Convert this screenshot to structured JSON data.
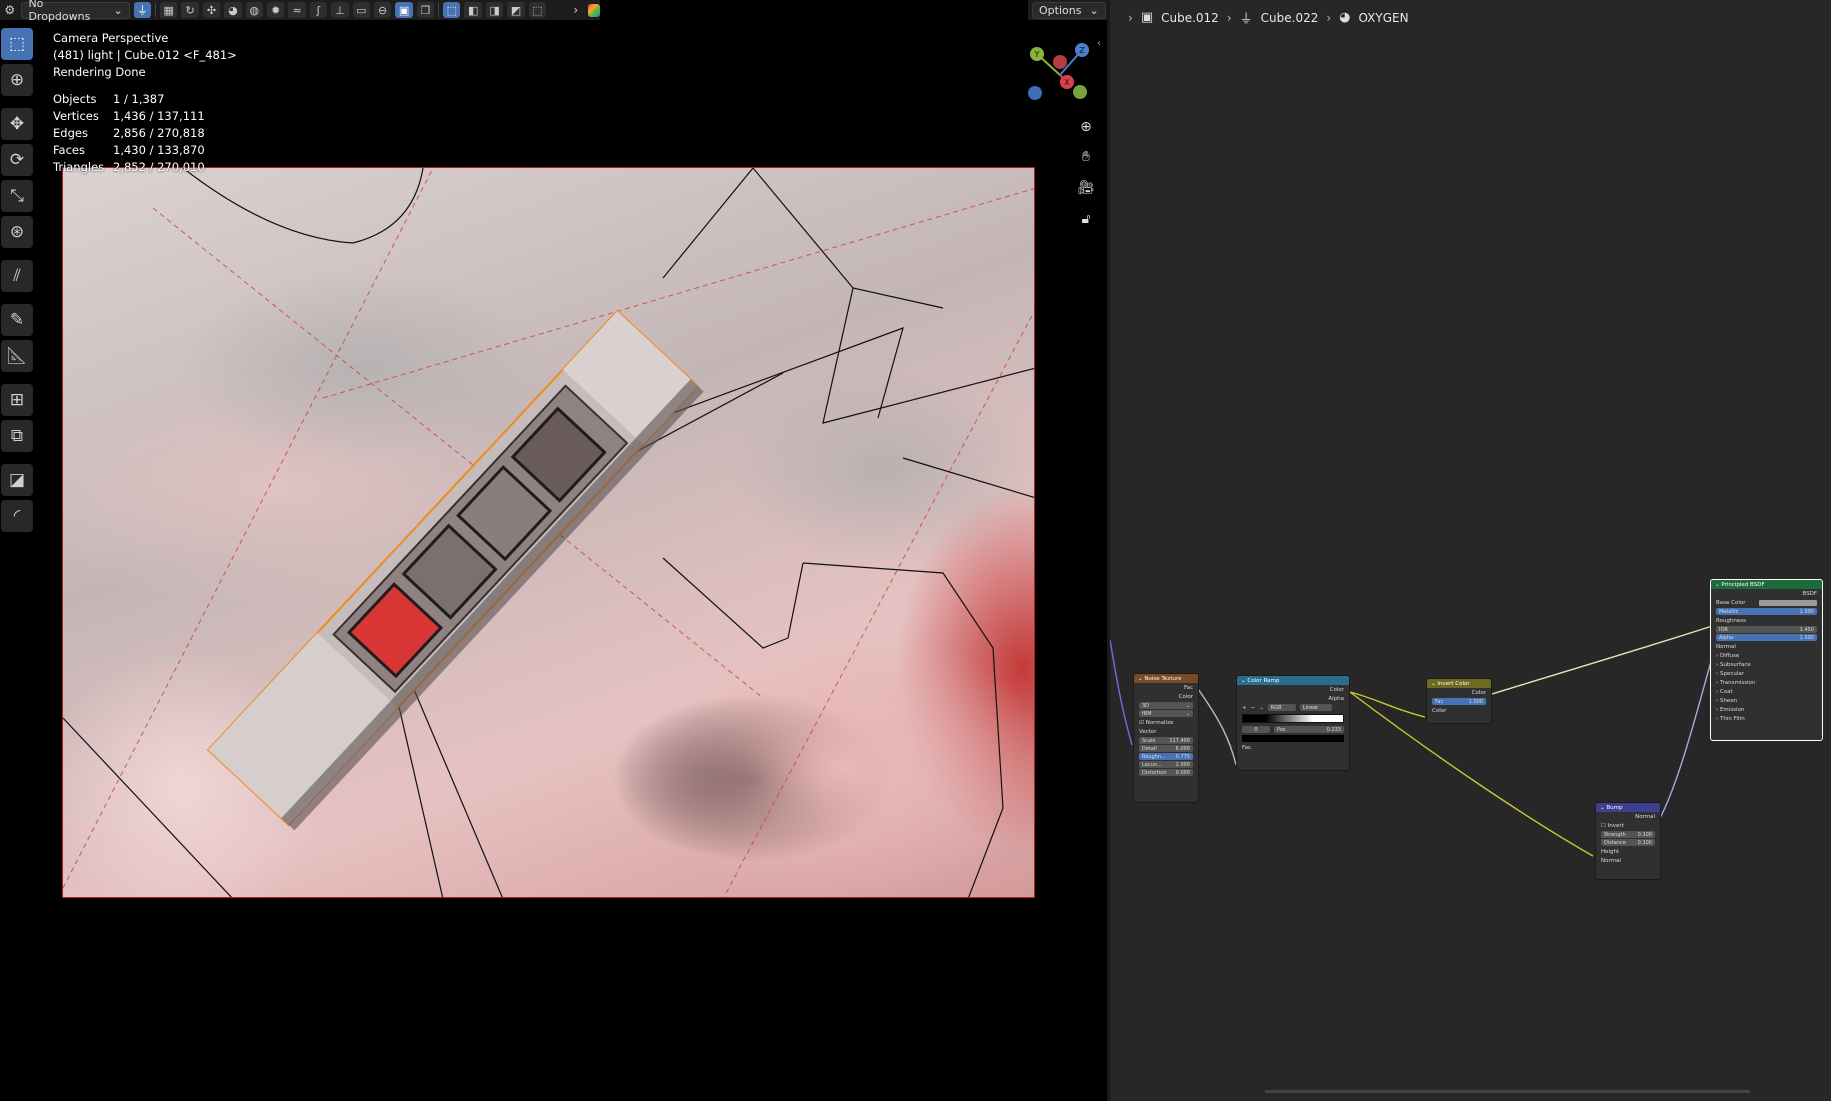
{
  "viewport_header": {
    "dropdown_label": "No Dropdowns",
    "options_label": "Options"
  },
  "stats": {
    "title": "Camera Perspective",
    "subtitle": "(481) light | Cube.012 <F_481>",
    "status": "Rendering Done",
    "rows": [
      {
        "label": "Objects",
        "value": "1 / 1,387"
      },
      {
        "label": "Vertices",
        "value": "1,436 / 137,111"
      },
      {
        "label": "Edges",
        "value": "2,856 / 270,818"
      },
      {
        "label": "Faces",
        "value": "1,430 / 133,870"
      },
      {
        "label": "Triangles",
        "value": "2,852 / 270,010"
      }
    ]
  },
  "gizmo": {
    "y": "Y",
    "z": "Z",
    "x": "X"
  },
  "breadcrumb": {
    "object": "Cube.012",
    "mesh": "Cube.022",
    "material": "OXYGEN"
  },
  "nodes": {
    "noise": {
      "title": "Noise Texture",
      "out_fac": "Fac",
      "out_color": "Color",
      "dim": "3D",
      "type": "fBM",
      "normalize": "Normalize",
      "vector": "Vector",
      "scale_l": "Scale",
      "scale_v": "117.400",
      "detail_l": "Detail",
      "detail_v": "6.000",
      "rough_l": "Roughn...",
      "rough_v": "0.775",
      "lacun_l": "Lacun...",
      "lacun_v": "2.000",
      "dist_l": "Distortion",
      "dist_v": "0.000"
    },
    "ramp": {
      "title": "Color Ramp",
      "out_color": "Color",
      "out_alpha": "Alpha",
      "mode": "RGB",
      "interp": "Linear",
      "idx": "0",
      "pos_l": "Pos",
      "pos_v": "0.233",
      "in_fac": "Fac"
    },
    "invert": {
      "title": "Invert Color",
      "out_color": "Color",
      "fac_l": "Fac",
      "fac_v": "1.000",
      "in_color": "Color"
    },
    "bump": {
      "title": "Bump",
      "out_normal": "Normal",
      "invert": "Invert",
      "strength_l": "Strength",
      "strength_v": "0.100",
      "distance_l": "Distance",
      "distance_v": "0.100",
      "height": "Height",
      "normal": "Normal"
    },
    "bsdf": {
      "title": "Principled BSDF",
      "out": "BSDF",
      "base_color": "Base Color",
      "metallic_l": "Metallic",
      "metallic_v": "1.000",
      "roughness": "Roughness",
      "ior_l": "IOR",
      "ior_v": "1.450",
      "alpha_l": "Alpha",
      "alpha_v": "1.000",
      "normal": "Normal",
      "panels": [
        "Diffuse",
        "Subsurface",
        "Specular",
        "Transmission",
        "Coat",
        "Sheen",
        "Emission",
        "Thin Film"
      ]
    }
  },
  "colors": {
    "accent": "#4772b3",
    "selection_outline": "#f08a1c",
    "render_tint": "#d49a9a"
  }
}
